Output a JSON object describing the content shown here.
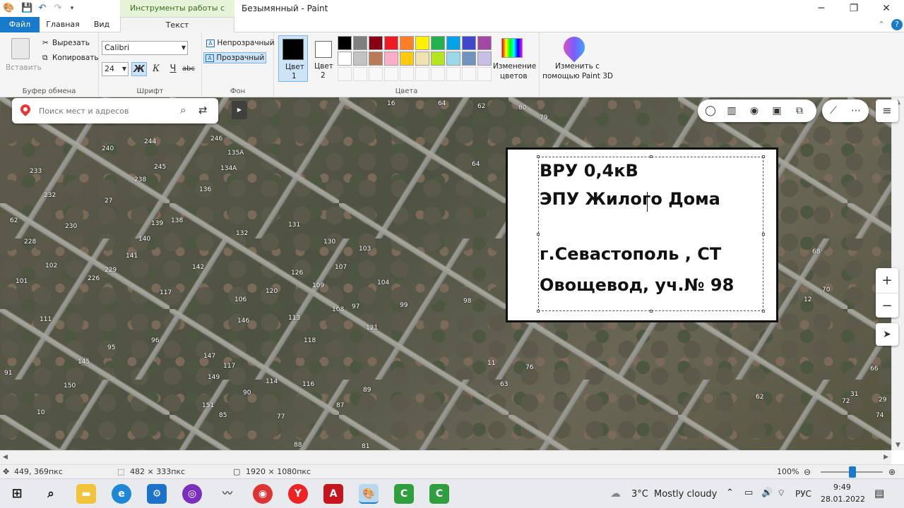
{
  "app": {
    "title": "Безымянный - Paint",
    "context_tab": "Инструменты работы с текстом"
  },
  "tabs": {
    "file": "Файл",
    "home": "Главная",
    "view": "Вид",
    "text": "Текст"
  },
  "ribbon": {
    "clipboard": {
      "paste": "Вставить",
      "cut": "Вырезать",
      "copy": "Копировать",
      "label": "Буфер обмена"
    },
    "font": {
      "family": "Calibri",
      "size": "24",
      "bold": "Ж",
      "italic": "К",
      "underline": "Ч",
      "strike": "abc",
      "label": "Шрифт"
    },
    "background": {
      "opaque": "Непрозрачный",
      "transparent": "Прозрачный",
      "label": "Фон"
    },
    "colors": {
      "color1": "Цвет",
      "color1_num": "1",
      "color2": "Цвет",
      "color2_num": "2",
      "edit_line1": "Изменение",
      "edit_line2": "цветов",
      "label": "Цвета",
      "color1_value": "#000000",
      "color2_value": "#ffffff",
      "palette_row1": [
        "#000000",
        "#7f7f7f",
        "#880015",
        "#ed1c24",
        "#ff7f27",
        "#fff200",
        "#22b14c",
        "#00a2e8",
        "#3f48cc",
        "#a349a4"
      ],
      "palette_row2": [
        "#ffffff",
        "#c3c3c3",
        "#b97a57",
        "#ffaec9",
        "#ffc90e",
        "#efe4b0",
        "#b5e61d",
        "#99d9ea",
        "#7092be",
        "#c8bfe7"
      ]
    },
    "paint3d": {
      "line1": "Изменить с",
      "line2": "помощью Paint 3D"
    }
  },
  "map": {
    "search_placeholder": "Поиск мест и адресов",
    "numbers": [
      "16",
      "64",
      "62",
      "80",
      "79",
      "240",
      "244",
      "246",
      "135А",
      "233",
      "232",
      "245",
      "134А",
      "238",
      "27",
      "136",
      "62",
      "230",
      "139",
      "138",
      "131",
      "132",
      "228",
      "140",
      "141",
      "130",
      "103",
      "102",
      "229",
      "142",
      "126",
      "107",
      "104",
      "101",
      "226",
      "117",
      "120",
      "109",
      "106",
      "111",
      "146",
      "113",
      "108",
      "97",
      "99",
      "98",
      "121",
      "96",
      "118",
      "95",
      "145",
      "147",
      "117",
      "114",
      "91",
      "150",
      "149",
      "116",
      "90",
      "89",
      "10",
      "151",
      "85",
      "87",
      "77",
      "88",
      "81",
      "11",
      "64",
      "12",
      "70",
      "68",
      "66",
      "76",
      "63",
      "62",
      "31",
      "72",
      "29",
      "74"
    ]
  },
  "label": {
    "line1": "ВРУ 0,4кВ",
    "line2": "ЭПУ Жилого Дома",
    "line3": "г.Севастополь , СТ",
    "line4": "Овощевод, уч.№ 98"
  },
  "status": {
    "cursor_pos": "449, 369пкс",
    "selection_size": "482 × 333пкс",
    "image_size": "1920 × 1080пкс",
    "zoom": "100%"
  },
  "taskbar": {
    "weather_temp": "3°C",
    "weather_text": "Mostly cloudy",
    "language": "РУС",
    "time": "9:49",
    "date": "28.01.2022"
  }
}
